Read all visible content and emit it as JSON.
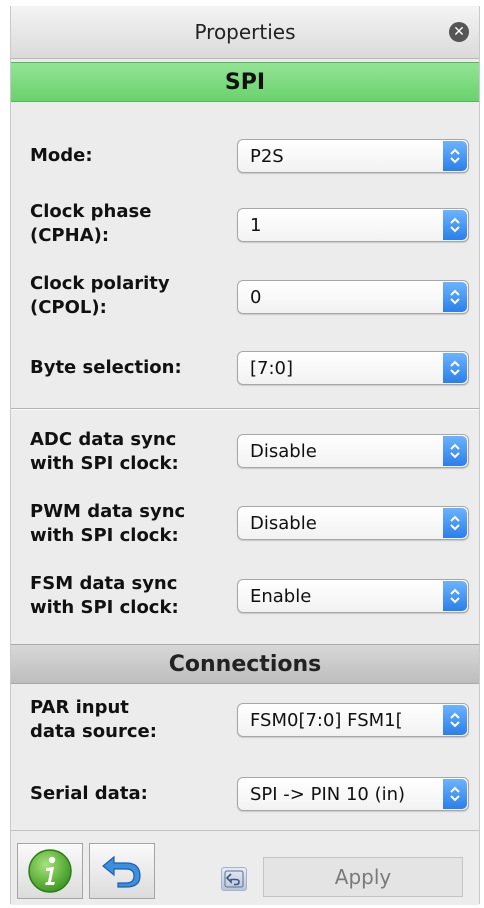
{
  "window": {
    "title": "Properties"
  },
  "sections": {
    "spi": "SPI",
    "connections": "Connections"
  },
  "fields": {
    "mode": {
      "label": "Mode:",
      "value": "P2S"
    },
    "clock_phase": {
      "label_line1": "Clock phase",
      "label_line2": "(CPHA):",
      "value": "1"
    },
    "clock_polarity": {
      "label_line1": "Clock polarity",
      "label_line2": "(CPOL):",
      "value": "0"
    },
    "byte_selection": {
      "label": "Byte selection:",
      "value": "[7:0]"
    },
    "adc_sync": {
      "label_line1": "ADC data sync",
      "label_line2": "with SPI clock:",
      "value": "Disable"
    },
    "pwm_sync": {
      "label_line1": "PWM data sync",
      "label_line2": "with SPI clock:",
      "value": "Disable"
    },
    "fsm_sync": {
      "label_line1": "FSM data sync",
      "label_line2": "with SPI clock:",
      "value": "Enable"
    },
    "par_input": {
      "label_line1": "PAR input",
      "label_line2": "data source:",
      "value": "FSM0[7:0] FSM1["
    },
    "serial_data": {
      "label": "Serial data:",
      "value": "SPI -> PIN 10 (in)"
    }
  },
  "footer": {
    "apply_label": "Apply"
  },
  "icons": {
    "close": "close-icon",
    "info": "info-icon",
    "undo": "undo-icon",
    "select_arrows": "updown-arrows-icon"
  },
  "colors": {
    "spi_header": "#6ad26d",
    "select_arrow": "#2a7fea",
    "info_green": "#5fb83a"
  }
}
